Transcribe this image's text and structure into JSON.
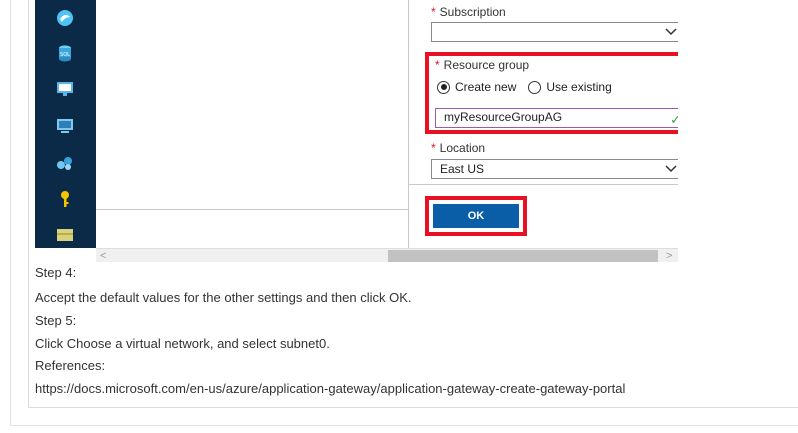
{
  "screenshot": {
    "subscription": {
      "label": "Subscription",
      "value": ""
    },
    "resource_group": {
      "label": "Resource group",
      "create_new": "Create new",
      "use_existing": "Use existing",
      "value": "myResourceGroupAG"
    },
    "location": {
      "label": "Location",
      "value": "East US"
    },
    "ok_label": "OK",
    "required_mark": "*"
  },
  "steps": {
    "step4_title": "Step 4:",
    "step4_text": "Accept the default values for the other settings and then click OK.",
    "step5_title": "Step 5:",
    "step5_text": "Click Choose a virtual network, and select subnet0.",
    "references_title": "References:",
    "reference_url": "https://docs.microsoft.com/en-us/azure/application-gateway/application-gateway-create-gateway-portal"
  },
  "icons": [
    "azure-icon",
    "sql-icon",
    "monitor-icon",
    "vm-icon",
    "network-icon",
    "key-icon",
    "storage-icon"
  ],
  "colors": {
    "nav_bg": "#0b2a47",
    "highlight": "#e81123",
    "ok_button": "#0a5ea8",
    "valid_check": "#3ba541"
  }
}
